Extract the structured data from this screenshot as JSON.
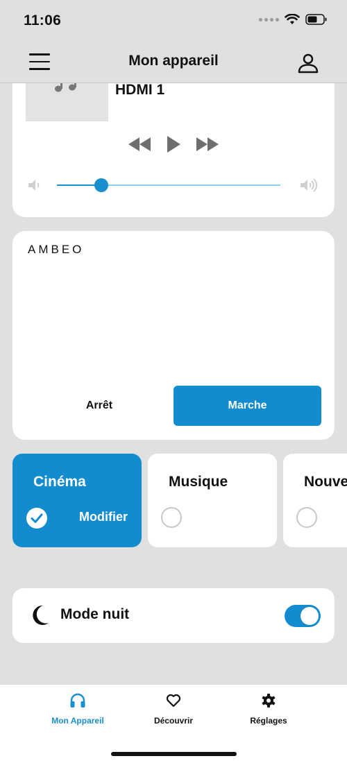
{
  "status_bar": {
    "time": "11:06"
  },
  "header": {
    "title": "Mon appareil"
  },
  "player": {
    "source": "HDMI 1",
    "volume_level": 0.2
  },
  "ambeo": {
    "logo": "AMBEO",
    "off_label": "Arrêt",
    "on_label": "Marche"
  },
  "modes": [
    {
      "name": "Cinéma",
      "selected": true,
      "edit_label": "Modifier"
    },
    {
      "name": "Musique",
      "selected": false
    },
    {
      "name": "Nouve",
      "selected": false
    }
  ],
  "night_mode": {
    "label": "Mode nuit",
    "enabled": true
  },
  "tabbar": {
    "tabs": [
      {
        "label": "Mon Appareil",
        "icon": "headphones-icon",
        "active": true
      },
      {
        "label": "Découvrir",
        "icon": "heart-icon",
        "active": false
      },
      {
        "label": "Réglages",
        "icon": "gear-icon",
        "active": false
      }
    ]
  },
  "colors": {
    "accent": "#128ccf",
    "background": "#e0e0e0",
    "card": "#ffffff"
  }
}
